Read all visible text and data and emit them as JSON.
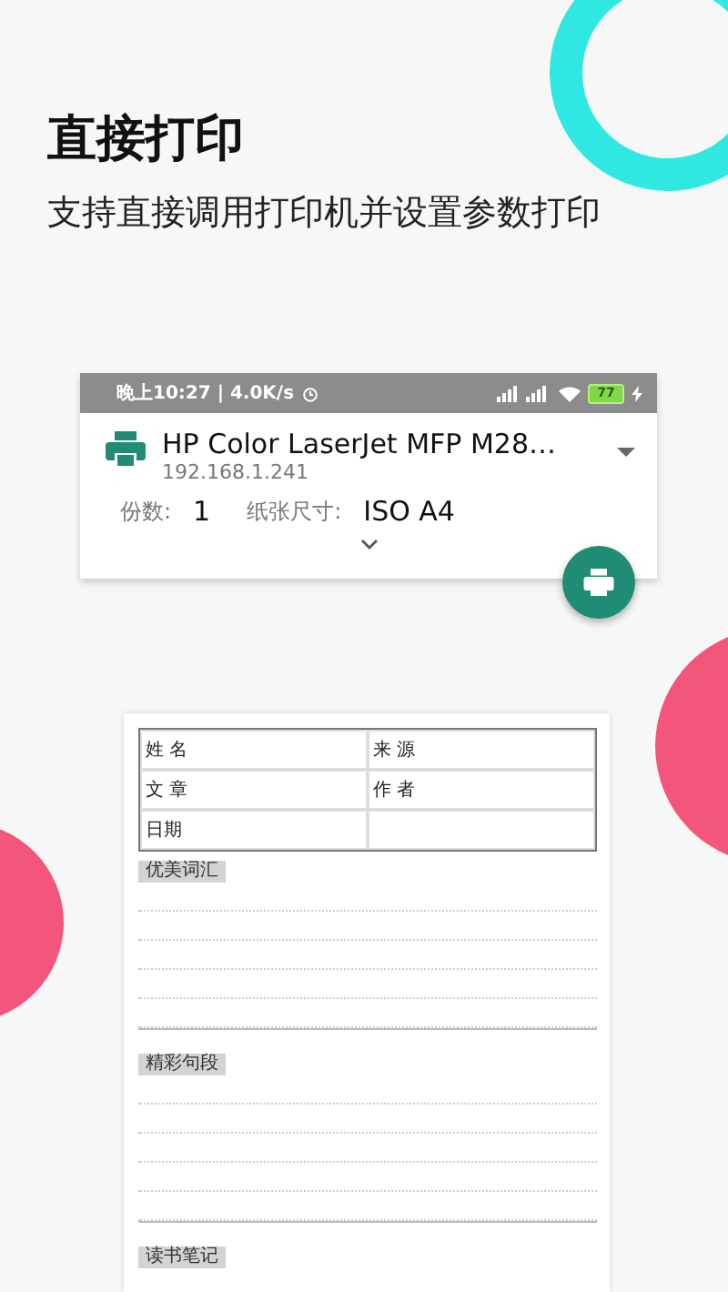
{
  "heading": {
    "title": "直接打印",
    "subtitle": "支持直接调用打印机并设置参数打印"
  },
  "status_bar": {
    "time": "晚上10:27 | 4.0K/s",
    "battery": "77"
  },
  "printer": {
    "name": "HP Color LaserJet MFP M28…",
    "address": "192.168.1.241"
  },
  "settings": [
    {
      "label": "份数:",
      "value": "1"
    },
    {
      "label": "纸张尺寸:",
      "value": "ISO A4"
    }
  ],
  "preview": {
    "table": [
      {
        "cells": [
          "姓 名",
          "来 源"
        ]
      },
      {
        "cells": [
          "文 章",
          "作 者"
        ]
      },
      {
        "cells": [
          "日期"
        ]
      }
    ],
    "sections": [
      {
        "label": "优美词汇"
      },
      {
        "label": "精彩句段"
      },
      {
        "label": "读书笔记"
      }
    ]
  }
}
